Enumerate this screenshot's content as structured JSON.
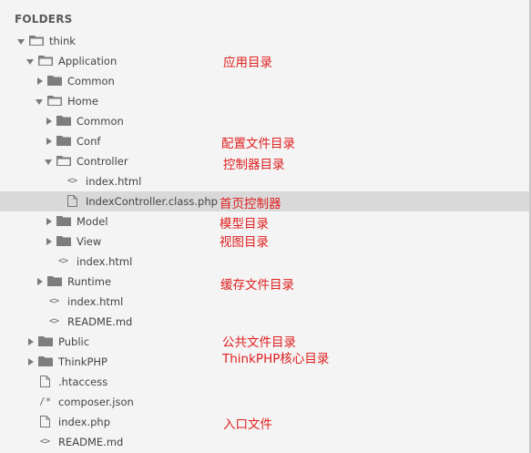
{
  "sidebar": {
    "header": "FOLDERS",
    "items": [
      {
        "label": "think",
        "type": "folder",
        "expanded": true
      },
      {
        "label": "Application",
        "type": "folder",
        "expanded": true
      },
      {
        "label": "Common",
        "type": "folder",
        "expanded": false
      },
      {
        "label": "Home",
        "type": "folder",
        "expanded": true
      },
      {
        "label": "Common",
        "type": "folder",
        "expanded": false
      },
      {
        "label": "Conf",
        "type": "folder",
        "expanded": false
      },
      {
        "label": "Controller",
        "type": "folder",
        "expanded": true
      },
      {
        "label": "index.html",
        "type": "file-code"
      },
      {
        "label": "IndexController.class.php",
        "type": "file",
        "selected": true
      },
      {
        "label": "Model",
        "type": "folder",
        "expanded": false
      },
      {
        "label": "View",
        "type": "folder",
        "expanded": false
      },
      {
        "label": "index.html",
        "type": "file-code"
      },
      {
        "label": "Runtime",
        "type": "folder",
        "expanded": false
      },
      {
        "label": "index.html",
        "type": "file-code"
      },
      {
        "label": "README.md",
        "type": "file-code"
      },
      {
        "label": "Public",
        "type": "folder",
        "expanded": false
      },
      {
        "label": "ThinkPHP",
        "type": "folder",
        "expanded": false
      },
      {
        "label": ".htaccess",
        "type": "file"
      },
      {
        "label": "composer.json",
        "type": "file-comment"
      },
      {
        "label": "index.php",
        "type": "file"
      },
      {
        "label": "README.md",
        "type": "file-code"
      }
    ]
  },
  "annotations": {
    "application": "应用目录",
    "conf": "配置文件目录",
    "controller": "控制器目录",
    "index_controller": "首页控制器",
    "model": "模型目录",
    "view": "视图目录",
    "runtime": "缓存文件目录",
    "public": "公共文件目录",
    "thinkphp": "ThinkPHP核心目录",
    "index_php": "入口文件"
  },
  "colors": {
    "annotation": "#e02020",
    "selected_row": "#d9d9d9",
    "background": "#f4f4f4",
    "folder_icon": "#7d7d7d"
  }
}
